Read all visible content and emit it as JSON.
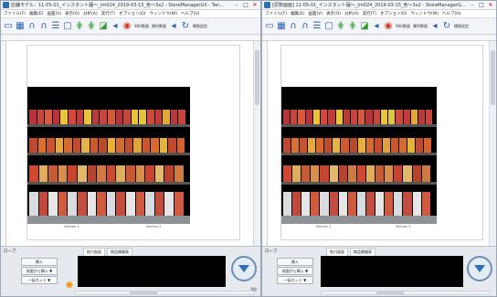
{
  "left_window": {
    "title": "店舗モデル：11-05-01_インスタント麺～_(m024_2019-03-15_色～3x2 - StoreManagerGX - Tan...",
    "menu": [
      "ファイル(F)",
      "編集(E)",
      "画面(V)",
      "表示(O)",
      "分析(A)",
      "実行(T)",
      "オプション(O)",
      "ウィンドウ(W)",
      "ヘルプ(H)"
    ],
    "toolbar_label_1": "SKU数量",
    "toolbar_label_2": "陳列数量",
    "toolbar_label_3": "棚割設定",
    "section_label_1": "Section 1",
    "section_label_2": "Section 2",
    "panel_title": "ロープ",
    "tabs": [
      "貼付画面",
      "商品情報表"
    ],
    "buttons": [
      "挿入",
      "前面から挿入 ▼",
      "一括カット ▼"
    ],
    "zoom": "0倍"
  },
  "right_window": {
    "title": "[原数画面] 11-05-01_インスタント麺～_(m024_2019-03-15_色～3x2 - StoreManagerG...",
    "menu": [
      "ファイル(F)",
      "編集(E)",
      "画面(V)",
      "表示(O)",
      "分析(A)",
      "実行(T)",
      "オプション(O)",
      "ウィンドウ(W)",
      "ヘルプ(H)"
    ],
    "toolbar_label_1": "SKU数量",
    "toolbar_label_2": "陳列数量",
    "toolbar_label_3": "棚割設定",
    "section_label_1": "Section 1",
    "section_label_2": "Section 2",
    "panel_title": "ロープ",
    "tabs": [
      "貼付画面",
      "商品情報表"
    ],
    "buttons": [
      "挿入",
      "前面から挿入 ▼",
      "一括カット ▼"
    ]
  },
  "window_buttons": {
    "min": "–",
    "max": "□",
    "close": "✕"
  },
  "icons": [
    "new-doc-icon",
    "grid-icon",
    "shelf-icon",
    "shelf-icon",
    "rack-icon",
    "basket-icon",
    "snap-icon",
    "align-icon",
    "layout-icon",
    "link-icon",
    "rotate-icon",
    "alert-icon",
    "sound-icon",
    "refresh-icon"
  ],
  "colors": {
    "accent": "#2f6fb5",
    "shelf": "#000000",
    "base": "#8d9296",
    "panel": "#e6eaef"
  },
  "products": {
    "row1": [
      "#b8323a",
      "#c7463b",
      "#d95a3c",
      "#b8323a",
      "#e8c43a",
      "#d9473a",
      "#c23a3a",
      "#e8c43a",
      "#b73b3b",
      "#c9443f",
      "#d35a3a",
      "#b8323a",
      "#c7463b",
      "#e8c43a",
      "#e0c33e",
      "#d04a3b",
      "#c33b3b",
      "#e2a83a",
      "#b73b3b",
      "#c9443f"
    ],
    "row2": [
      "#c0482e",
      "#d86e2f",
      "#c9532e",
      "#e6a83a",
      "#d66a30",
      "#c14b2e",
      "#e3b24a",
      "#cf5a2e",
      "#b84a2c",
      "#e8b03b",
      "#d46c2f",
      "#c44d2d",
      "#e1a23a",
      "#c8572e",
      "#d86a2f",
      "#e5b23a",
      "#c2492d",
      "#d2622f"
    ],
    "row3": [
      "#d0482f",
      "#e0ad5c",
      "#c65a34",
      "#d88f4c",
      "#c9442f",
      "#e4b86a",
      "#b8432c",
      "#cf7a42",
      "#d0482f",
      "#e0ad5c",
      "#c65a34",
      "#d88f4c",
      "#c9442f",
      "#e4b86a",
      "#b8432c",
      "#cf7a42"
    ],
    "row4": [
      "#dadde0",
      "#c14a3c",
      "#e6e6e6",
      "#d35a3d",
      "#d8dce0",
      "#c34d3e",
      "#e6e6e6",
      "#d05a3e",
      "#d8dce0",
      "#c34d3e",
      "#e6e6e6",
      "#d05a3e",
      "#d8dce0",
      "#c34d3e",
      "#e6e6e6",
      "#d05a3e"
    ]
  }
}
